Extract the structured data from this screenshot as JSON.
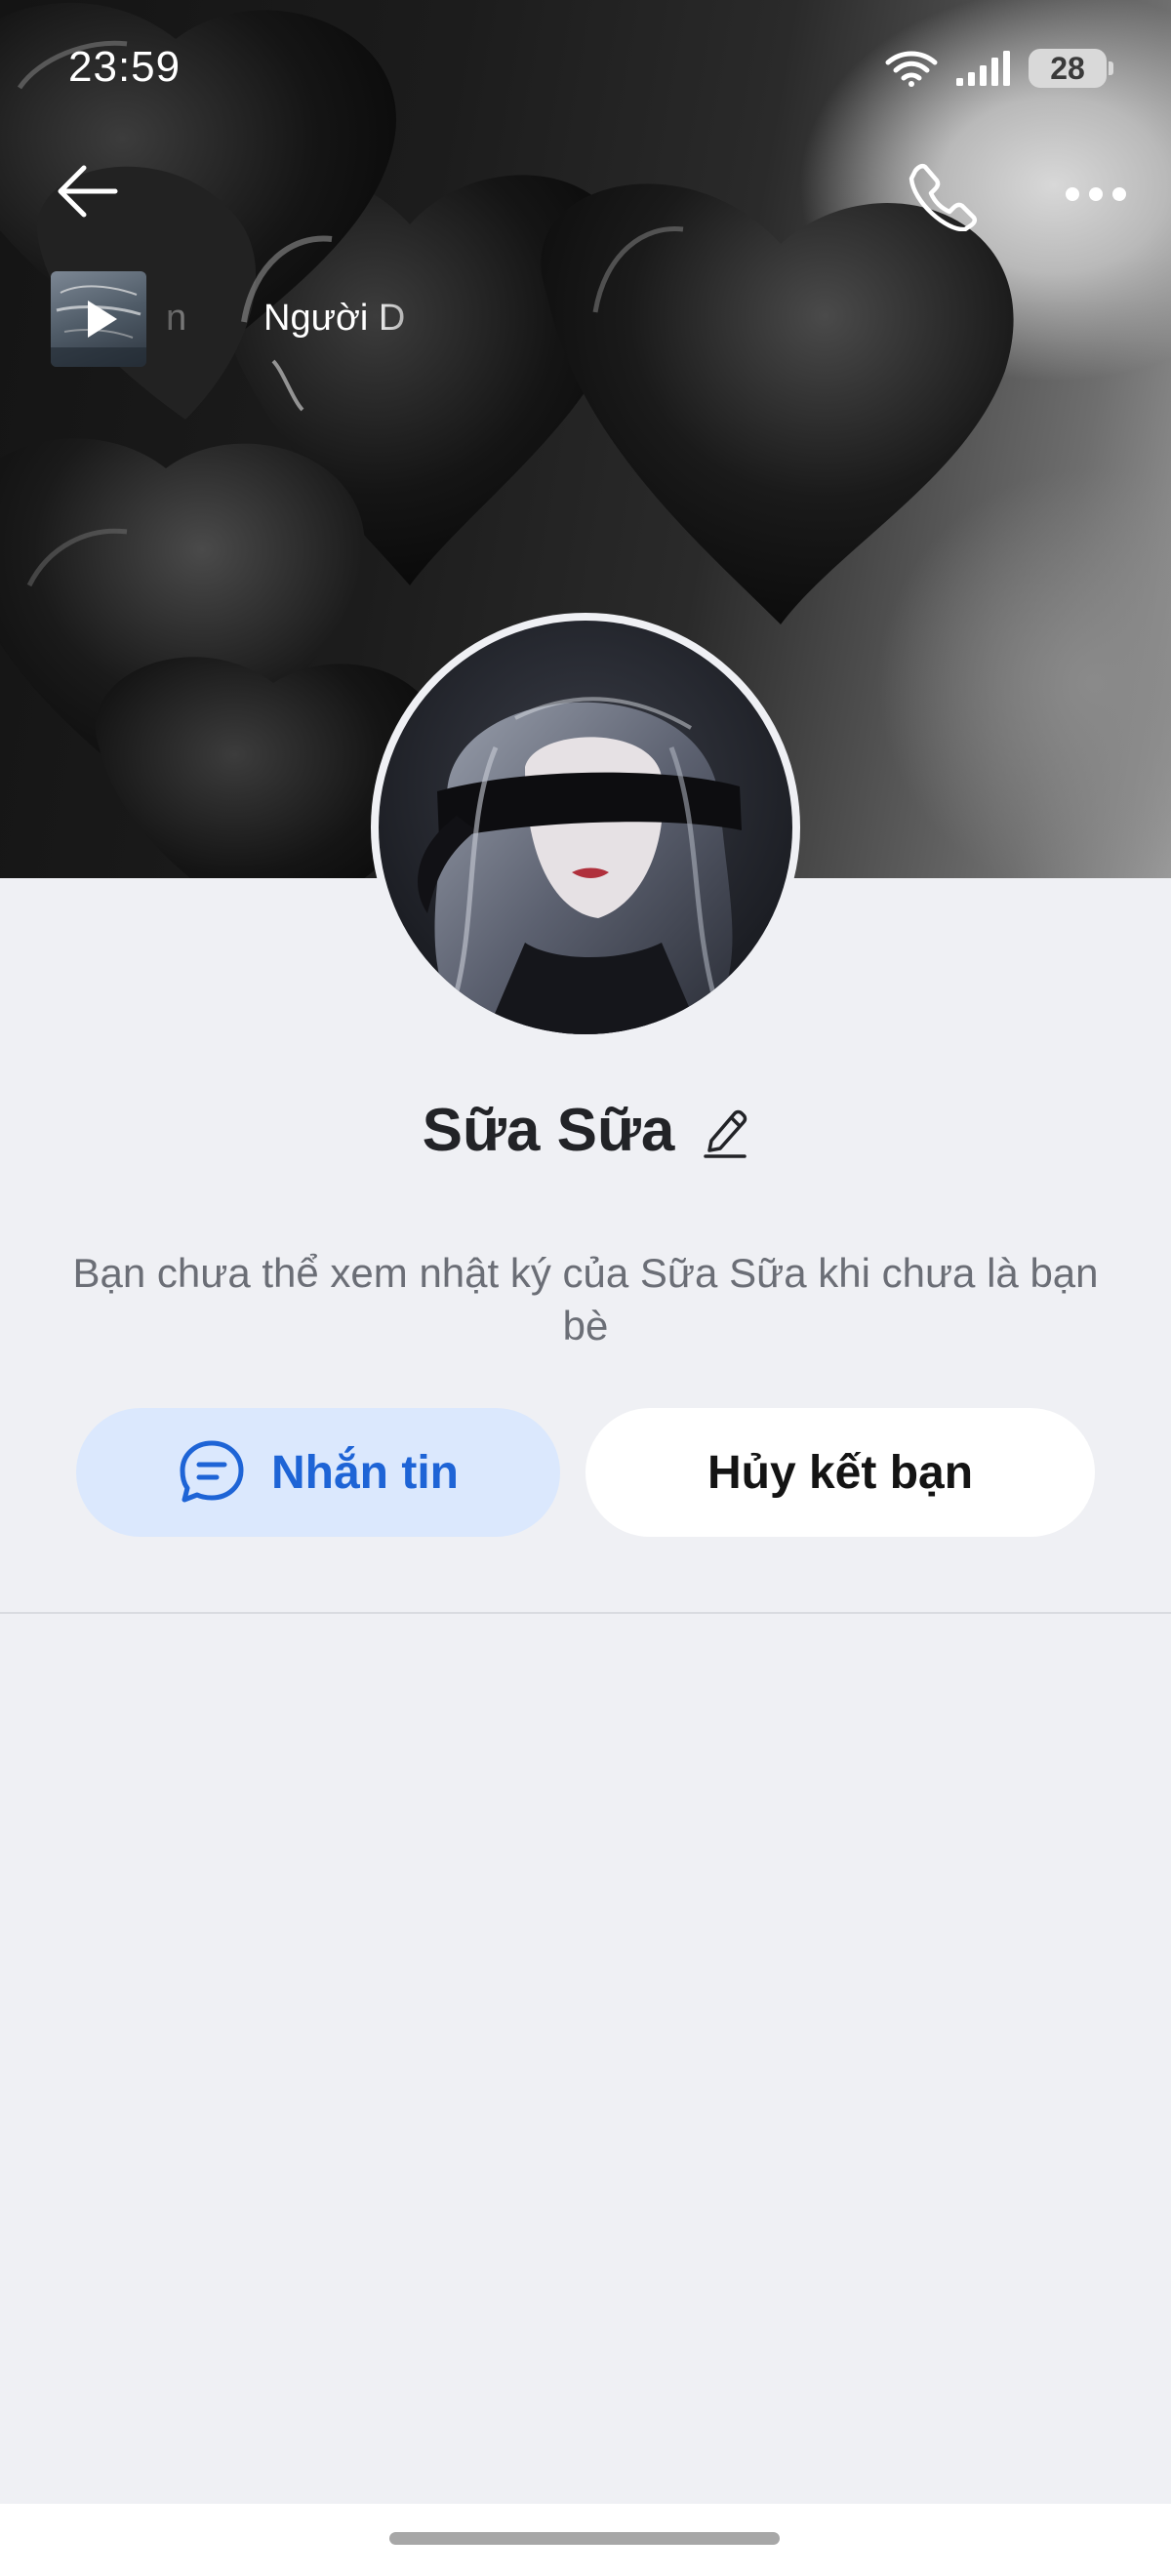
{
  "status_bar": {
    "time": "23:59",
    "battery_level": "28",
    "icons": [
      "wifi-icon",
      "signal-icon",
      "battery-icon"
    ]
  },
  "nav": {
    "back_icon": "arrow-left-icon",
    "call_icon": "phone-icon",
    "more_icon": "more-dots-icon"
  },
  "music": {
    "prev_fragment": "n",
    "title": "Người D"
  },
  "profile": {
    "name": "Sữa Sữa",
    "info_text": "Bạn chưa thể xem nhật ký của Sữa Sữa khi chưa là bạn bè"
  },
  "actions": {
    "message_label": "Nhắn tin",
    "unfriend_label": "Hủy kết bạn"
  },
  "colors": {
    "accent": "#1e64d6",
    "accent_bg": "#dbe8fd",
    "page_bg": "#eff0f4"
  }
}
